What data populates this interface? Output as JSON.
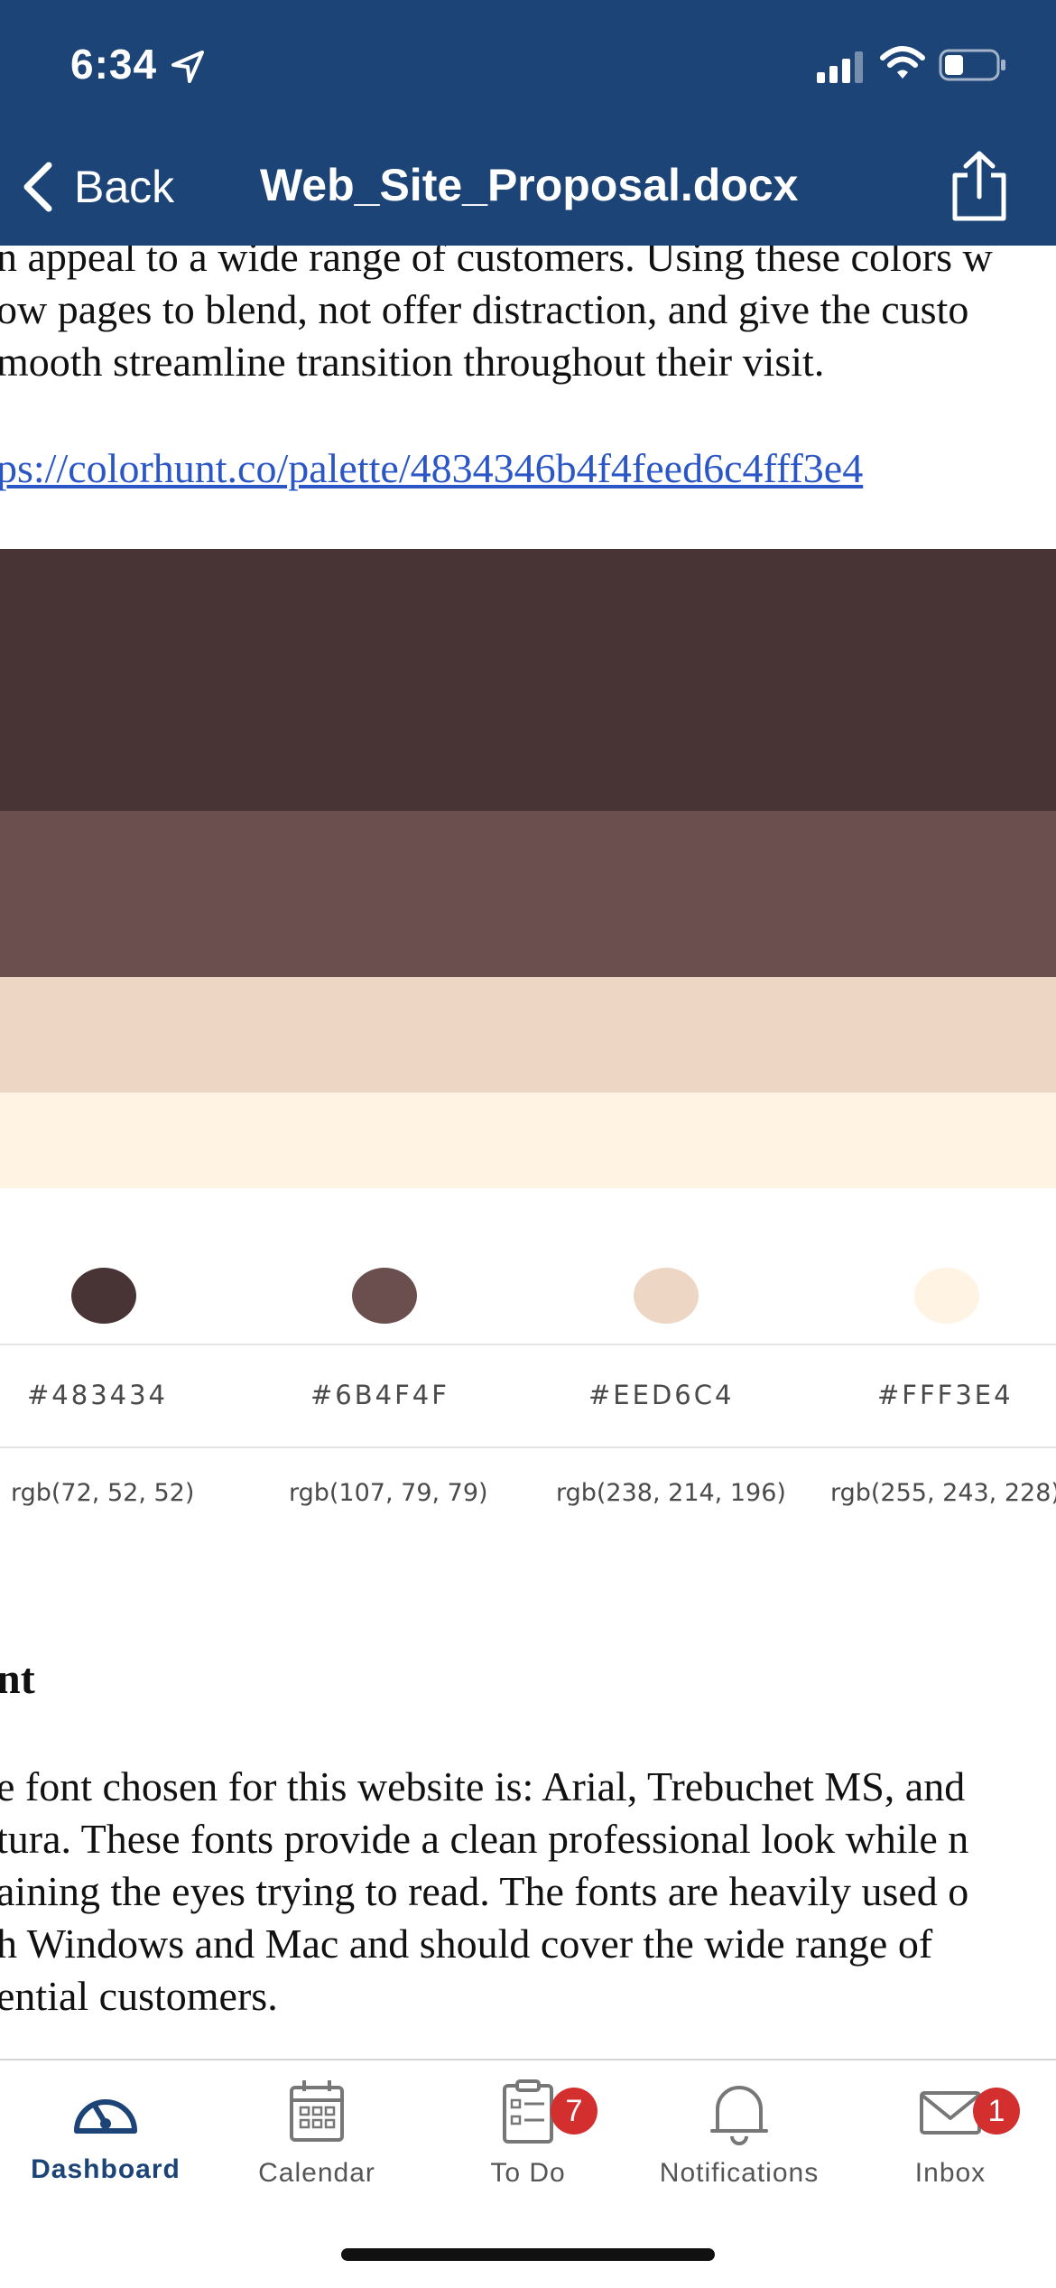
{
  "status_bar": {
    "time": "6:34"
  },
  "nav": {
    "back_label": "Back",
    "title": "Web_Site_Proposal.docx"
  },
  "document": {
    "intro_lines": [
      "n appeal to a wide range of customers. Using these colors w",
      "ow pages to blend, not offer distraction, and give the custo",
      "mooth streamline transition throughout their visit."
    ],
    "link": "ps://colorhunt.co/palette/4834346b4f4feed6c4fff3e4",
    "palette": [
      {
        "hex": "#483434",
        "rgb": "rgb(72, 52, 52)",
        "color": "#483434"
      },
      {
        "hex": "#6B4F4F",
        "rgb": "rgb(107, 79, 79)",
        "color": "#6B4F4F"
      },
      {
        "hex": "#EED6C4",
        "rgb": "rgb(238, 214, 196)",
        "color": "#EED6C4"
      },
      {
        "hex": "#FFF3E4",
        "rgb": "rgb(255, 243, 228)",
        "color": "#FFF3E4"
      }
    ],
    "heading": "nt",
    "font_lines": [
      "e font chosen for this website is: Arial, Trebuchet MS, and",
      "tura. These fonts provide a clean professional look while n",
      "aining the eyes trying to read. The fonts are heavily used o",
      "h Windows and Mac and should cover the wide range of",
      "ential customers."
    ]
  },
  "tabs": [
    {
      "label": "Dashboard",
      "icon": "dashboard-icon",
      "active": true
    },
    {
      "label": "Calendar",
      "icon": "calendar-icon"
    },
    {
      "label": "To Do",
      "icon": "todo-icon",
      "badge": "7"
    },
    {
      "label": "Notifications",
      "icon": "bell-icon"
    },
    {
      "label": "Inbox",
      "icon": "inbox-icon",
      "badge": "1"
    }
  ],
  "colors": {
    "header_bg": "#1d4477",
    "link": "#2a56c6",
    "badge": "#d32f2f"
  }
}
